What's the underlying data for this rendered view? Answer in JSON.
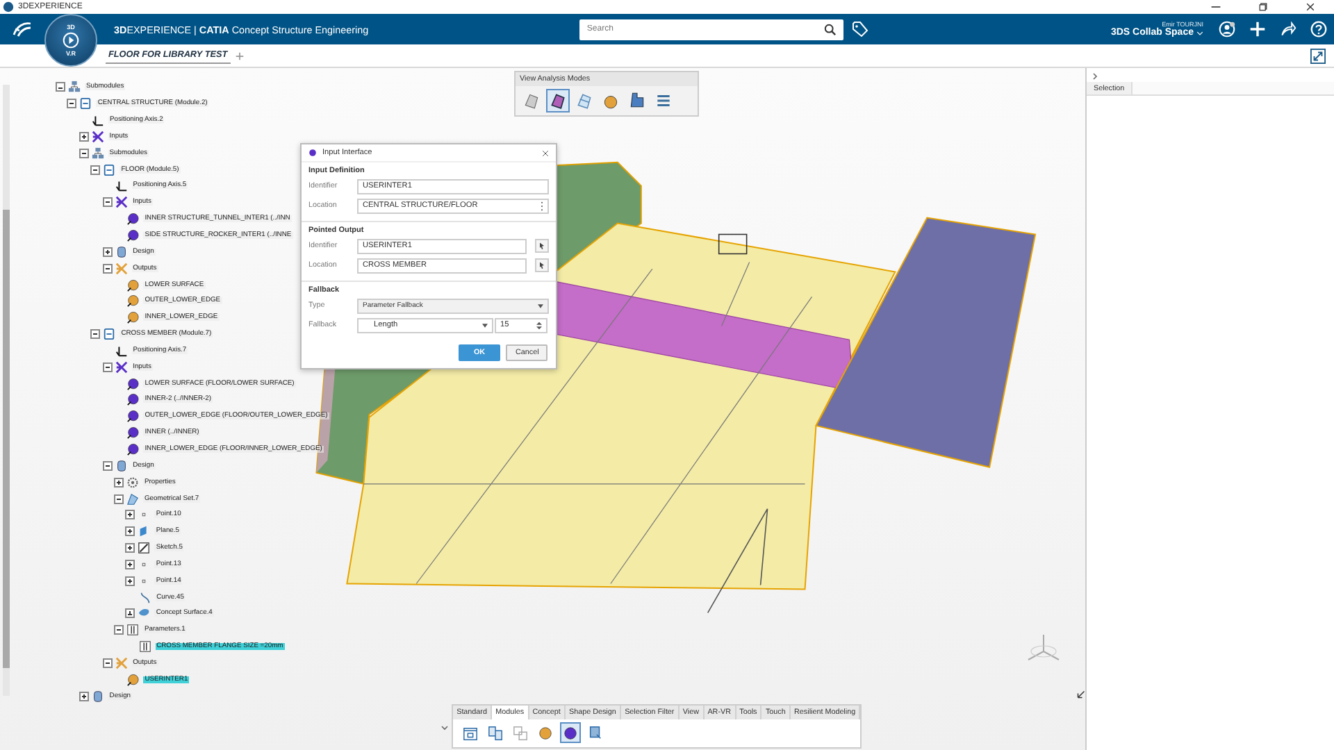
{
  "window": {
    "title": "3DEXPERIENCE"
  },
  "app_bar": {
    "brand": "**3D**EXPERIENCE | **CATIA** Concept Structure Engineering",
    "compass": {
      "top": "3D",
      "bottom": "V.R"
    },
    "search": {
      "placeholder": "Search"
    },
    "user": "Emir TOURJNI",
    "space": "3DS Collab Space"
  },
  "doc_tabs": [
    {
      "label": "FLOOR FOR LIBRARY TEST",
      "selected": true
    }
  ],
  "tree": [
    {
      "label": "Submodules",
      "kind": "submodules",
      "expanded": true,
      "selected": false,
      "children": [
        {
          "label": "CENTRAL STRUCTURE (Module.2)",
          "kind": "module",
          "expanded": true,
          "selected": false,
          "children": [
            {
              "label": "Positioning Axis.2",
              "kind": "axis",
              "selected": false
            },
            {
              "label": "Inputs",
              "kind": "inputs",
              "expanded": false,
              "selected": false
            },
            {
              "label": "Submodules",
              "kind": "submodules",
              "expanded": true,
              "selected": false,
              "children": [
                {
                  "label": "FLOOR (Module.5)",
                  "kind": "module",
                  "expanded": true,
                  "selected": false,
                  "children": [
                    {
                      "label": "Positioning Axis.5",
                      "kind": "axis",
                      "selected": false
                    },
                    {
                      "label": "Inputs",
                      "kind": "inputs",
                      "expanded": true,
                      "selected": false,
                      "children": [
                        {
                          "label": "INNER STRUCTURE_TUNNEL_INTER1 (../INN",
                          "kind": "input-pin",
                          "selected": false
                        },
                        {
                          "label": "SIDE STRUCTURE_ROCKER_INTER1 (../INNE",
                          "kind": "input-pin",
                          "selected": false
                        }
                      ]
                    },
                    {
                      "label": "Design",
                      "kind": "design",
                      "expanded": false,
                      "selected": false
                    },
                    {
                      "label": "Outputs",
                      "kind": "outputs",
                      "expanded": true,
                      "selected": false,
                      "children": [
                        {
                          "label": "LOWER SURFACE",
                          "kind": "output-pin",
                          "selected": false
                        },
                        {
                          "label": "OUTER_LOWER_EDGE",
                          "kind": "output-pin",
                          "selected": false
                        },
                        {
                          "label": "INNER_LOWER_EDGE",
                          "kind": "output-pin",
                          "selected": false
                        }
                      ]
                    }
                  ]
                },
                {
                  "label": "CROSS MEMBER (Module.7)",
                  "kind": "module",
                  "expanded": true,
                  "selected": false,
                  "children": [
                    {
                      "label": "Positioning Axis.7",
                      "kind": "axis",
                      "selected": false
                    },
                    {
                      "label": "Inputs",
                      "kind": "inputs",
                      "expanded": true,
                      "selected": false,
                      "children": [
                        {
                          "label": "LOWER SURFACE (FLOOR/LOWER SURFACE)",
                          "kind": "input-pin",
                          "selected": false
                        },
                        {
                          "label": "INNER-2 (../INNER-2)",
                          "kind": "input-pin",
                          "selected": false
                        },
                        {
                          "label": "OUTER_LOWER_EDGE (FLOOR/OUTER_LOWER_EDGE)",
                          "kind": "input-pin",
                          "selected": false
                        },
                        {
                          "label": "INNER (../INNER)",
                          "kind": "input-pin",
                          "selected": false
                        },
                        {
                          "label": "INNER_LOWER_EDGE (FLOOR/INNER_LOWER_EDGE)",
                          "kind": "input-pin",
                          "selected": false
                        }
                      ]
                    },
                    {
                      "label": "Design",
                      "kind": "design",
                      "expanded": true,
                      "selected": false,
                      "children": [
                        {
                          "label": "Properties",
                          "kind": "properties",
                          "expanded": false,
                          "selected": false
                        },
                        {
                          "label": "Geometrical Set.7",
                          "kind": "geoset",
                          "expanded": true,
                          "selected": false,
                          "children": [
                            {
                              "label": "Point.10",
                              "kind": "point",
                              "expanded": false,
                              "selected": false
                            },
                            {
                              "label": "Plane.5",
                              "kind": "plane",
                              "expanded": false,
                              "selected": false
                            },
                            {
                              "label": "Sketch.5",
                              "kind": "sketch",
                              "expanded": false,
                              "selected": false
                            },
                            {
                              "label": "Point.13",
                              "kind": "point",
                              "expanded": false,
                              "selected": false
                            },
                            {
                              "label": "Point.14",
                              "kind": "point",
                              "expanded": false,
                              "selected": false
                            },
                            {
                              "label": "Curve.45",
                              "kind": "curve",
                              "selected": false
                            },
                            {
                              "label": "Concept Surface.4",
                              "kind": "surface",
                              "expanded": false,
                              "selected": false
                            }
                          ]
                        },
                        {
                          "label": "Parameters.1",
                          "kind": "parameters",
                          "expanded": true,
                          "selected": false,
                          "children": [
                            {
                              "label": "CROSS MEMBER FLANGE SIZE =20mm",
                              "kind": "parameter",
                              "selected": true
                            }
                          ]
                        }
                      ]
                    },
                    {
                      "label": "Outputs",
                      "kind": "outputs",
                      "expanded": true,
                      "selected": false,
                      "children": [
                        {
                          "label": "USERINTER1",
                          "kind": "output-pin",
                          "selected": true
                        }
                      ]
                    }
                  ]
                }
              ]
            },
            {
              "label": "Design",
              "kind": "design",
              "expanded": false,
              "selected": false
            }
          ]
        }
      ]
    }
  ],
  "view_modes": {
    "title": "View Analysis Modes",
    "tools": [
      {
        "kind": "shaded",
        "selected": false
      },
      {
        "kind": "shaded-edges",
        "selected": true
      },
      {
        "kind": "wireframe",
        "selected": false
      },
      {
        "kind": "output-pin",
        "selected": false
      },
      {
        "kind": "analysis",
        "selected": false
      },
      {
        "kind": "layers",
        "selected": false
      }
    ]
  },
  "dialog": {
    "title": "Input Interface",
    "input_definition": {
      "heading": "Input Definition",
      "identifier_label": "Identifier",
      "identifier": "USERINTER1",
      "location_label": "Location",
      "location": "CENTRAL STRUCTURE/FLOOR"
    },
    "pointed_output": {
      "heading": "Pointed Output",
      "identifier_label": "Identifier",
      "identifier": "USERINTER1",
      "location_label": "Location",
      "location": "CROSS MEMBER"
    },
    "fallback": {
      "heading": "Fallback",
      "type_label": "Type",
      "type": "Parameter Fallback",
      "fallback_label": "Fallback",
      "unit": "Length",
      "value": "15"
    },
    "buttons": [
      {
        "label": "OK",
        "kind": "primary"
      },
      {
        "label": "Cancel",
        "kind": "secondary"
      }
    ]
  },
  "side_panel": {
    "title": "Selection"
  },
  "action_bar": {
    "tabs": [
      {
        "label": "Standard",
        "selected": false
      },
      {
        "label": "Modules",
        "selected": true
      },
      {
        "label": "Concept",
        "selected": false
      },
      {
        "label": "Shape Design",
        "selected": false
      },
      {
        "label": "Selection Filter",
        "selected": false
      },
      {
        "label": "View",
        "selected": false
      },
      {
        "label": "AR-VR",
        "selected": false
      },
      {
        "label": "Tools",
        "selected": false
      },
      {
        "label": "Touch",
        "selected": false
      },
      {
        "label": "Resilient Modeling",
        "selected": false
      }
    ],
    "tools": [
      {
        "kind": "module-window",
        "selected": false
      },
      {
        "kind": "module-copy",
        "selected": false
      },
      {
        "kind": "module-ghost",
        "selected": false
      },
      {
        "kind": "output-pin",
        "selected": false
      },
      {
        "kind": "input-pin",
        "selected": true
      },
      {
        "kind": "library",
        "selected": false
      }
    ]
  }
}
